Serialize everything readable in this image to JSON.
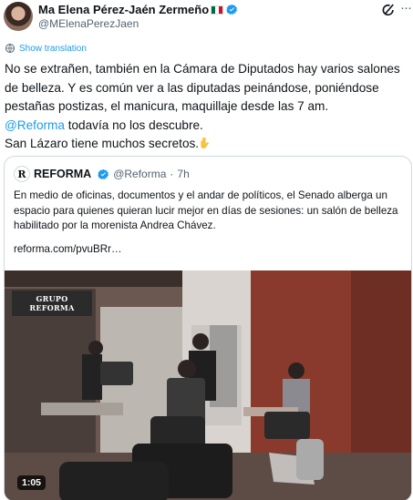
{
  "author": {
    "name": "Ma Elena Pérez-Jaén Zermeño",
    "handle": "@MElenaPerezJaen"
  },
  "translate": {
    "label": "Show translation"
  },
  "tweet": {
    "text_part1": "No se extrañen, también en la Cámara de Diputados hay varios salones de belleza. Y es común ver a las diputadas peinándose, poniéndose pestañas postizas, el manicura, maquillaje desde las 7 am.",
    "mention": "@Reforma",
    "text_part2": " todavía no los descubre.",
    "text_part3": "San Lázaro tiene muchos secretos."
  },
  "quote": {
    "logo_letter": "R",
    "name": "REFORMA",
    "handle": "@Reforma",
    "dot": "·",
    "time": "7h",
    "text": "En medio de oficinas, documentos y el andar de políticos, el Senado alberga un espacio para quienes quieran lucir mejor en días de sesiones: un salón de belleza habilitado por la morenista Andrea Chávez.",
    "link": "reforma.com/pvuBRr…"
  },
  "media": {
    "watermark_line1": "GRUPO",
    "watermark_line2": "REFORMA",
    "duration": "1:05"
  },
  "colors": {
    "accent": "#1d9bf0",
    "text": "#0f1419",
    "muted": "#536471",
    "border": "#cfd9de"
  }
}
